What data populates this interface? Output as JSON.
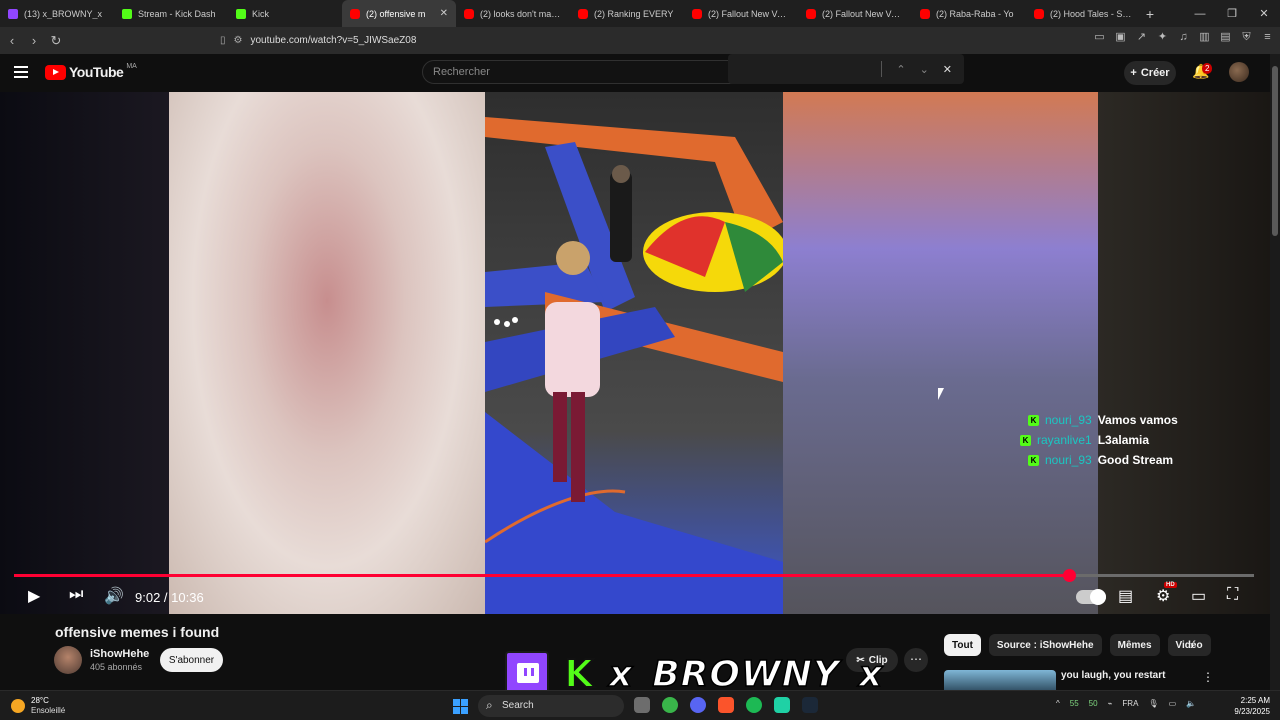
{
  "browser": {
    "tabs": [
      {
        "label": "(13) x_BROWNY_x",
        "favicon": "twitch"
      },
      {
        "label": "Stream - Kick Dash",
        "favicon": "kick"
      },
      {
        "label": "Kick",
        "favicon": "kick"
      },
      {
        "label": "(2) offensive m",
        "favicon": "yt",
        "active": true
      },
      {
        "label": "(2) looks don't matter.",
        "favicon": "yt"
      },
      {
        "label": "(2) Ranking EVERY",
        "favicon": "yt"
      },
      {
        "label": "(2) Fallout New Vegas",
        "favicon": "yt"
      },
      {
        "label": "(2) Fallout New Vegas",
        "favicon": "yt"
      },
      {
        "label": "(2) Raba-Raba - Yo",
        "favicon": "yt"
      },
      {
        "label": "(2) Hood Tales - Shoot",
        "favicon": "yt"
      }
    ],
    "url": "youtube.com/watch?v=5_JIWSaeZ08"
  },
  "youtube": {
    "logo_text": "YouTube",
    "region": "MA",
    "search_placeholder": "Rechercher",
    "create_label": "Créer",
    "notifications_count": "2"
  },
  "video": {
    "current_time": "9:02",
    "duration": "10:36",
    "progress_fraction": 0.851,
    "time_separator": " / ",
    "chat": [
      {
        "user": "nouri_93",
        "message": "Vamos vamos"
      },
      {
        "user": "rayanlive1",
        "message": "L3alamia"
      },
      {
        "user": "nouri_93",
        "message": "Good Stream"
      }
    ]
  },
  "meta": {
    "title": "offensive memes i found",
    "channel": "iShowHehe",
    "subscribers": "405 abonnés",
    "subscribe_label": "S'abonner",
    "clip_label": "Clip"
  },
  "chips": [
    "Tout",
    "Source : iShowHehe",
    "Mêmes",
    "Vidéo"
  ],
  "recommended": {
    "title": "you laugh, you restart"
  },
  "overlay": {
    "streamer_name": "x_BROWNY_x"
  },
  "taskbar": {
    "temperature": "28°C",
    "weather": "Ensoleillé",
    "search_label": "Search",
    "tray_a": "55",
    "tray_b": "50",
    "language": "FRA",
    "time": "2:25 AM",
    "date": "9/23/2025"
  }
}
